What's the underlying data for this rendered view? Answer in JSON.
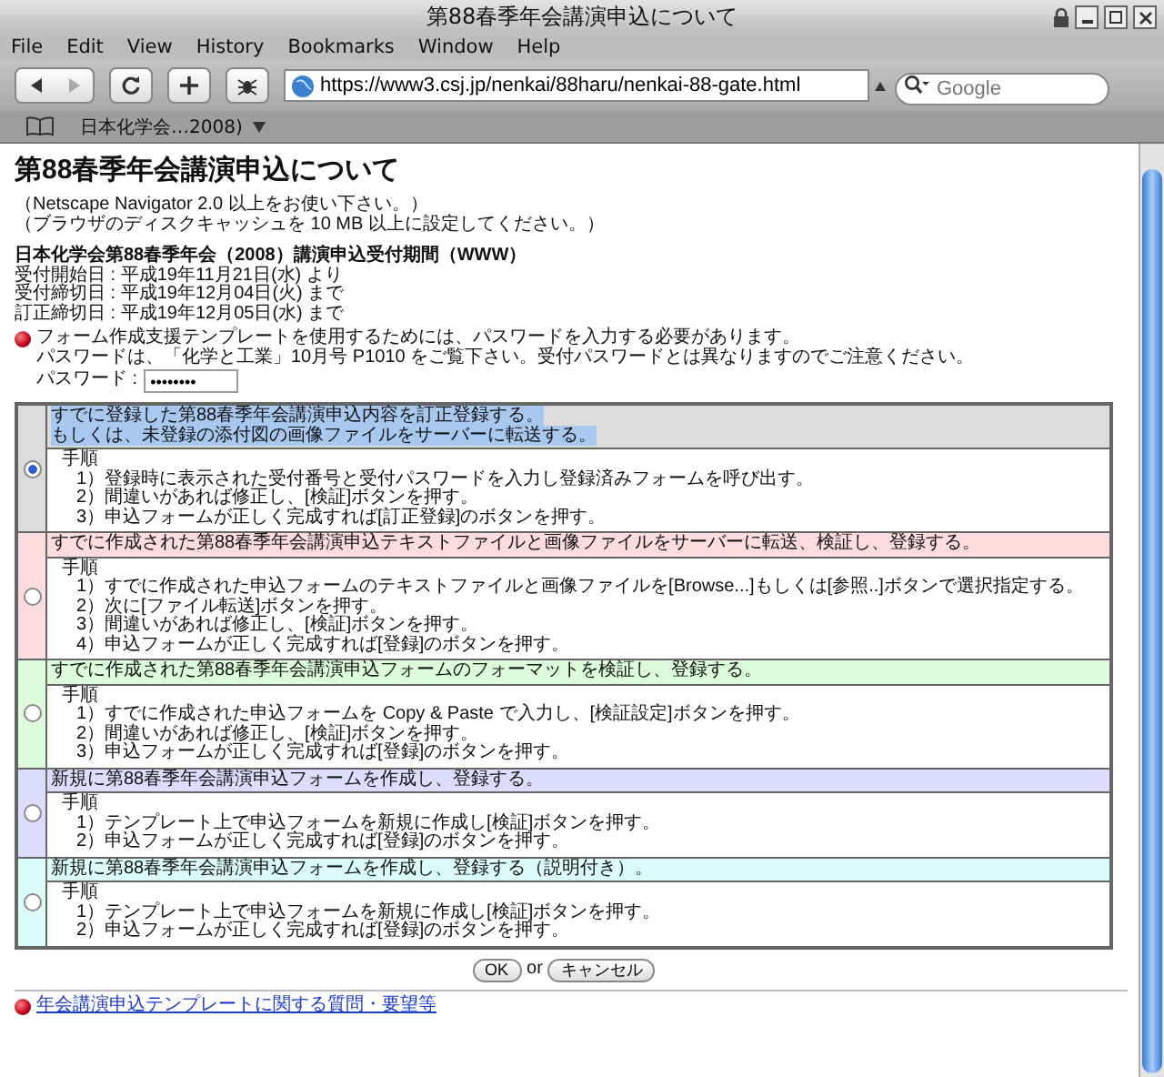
{
  "window": {
    "title": "第88春季年会講演申込について"
  },
  "menu": [
    "File",
    "Edit",
    "View",
    "History",
    "Bookmarks",
    "Window",
    "Help"
  ],
  "toolbar": {
    "url": "https://www3.csj.jp/nenkai/88haru/nenkai-88-gate.html",
    "search_placeholder": "Google"
  },
  "bookmarks": [
    "日本化学会…2008)"
  ],
  "page": {
    "heading": "第88春季年会講演申込について",
    "notes": [
      "（Netscape Navigator 2.0 以上をお使い下さい。）",
      "（ブラウザのディスクキャッシュを 10 MB 以上に設定してください。）"
    ],
    "period_title": "日本化学会第88春季年会（2008）講演申込受付期間（WWW）",
    "period_lines": [
      "受付開始日 : 平成19年11月21日(水) より",
      "受付締切日 : 平成19年12月04日(火) まで",
      "訂正締切日 : 平成19年12月05日(水) まで"
    ],
    "notice_lines": [
      "フォーム作成支援テンプレートを使用するためには、パスワードを入力する必要があります。",
      "パスワードは、「化学と工業」10月号 P1010 をご覧下さい。受付パスワードとは異なりますのでご注意ください。"
    ],
    "password": {
      "label": "パスワード :",
      "value": "••••••••"
    },
    "options": [
      {
        "selected": true,
        "text_selected": true,
        "color": "#dcdcdc",
        "header": [
          "すでに登録した第88春季年会講演申込内容を訂正登録する。",
          "もしくは、未登録の添付図の画像ファイルをサーバーに転送する。"
        ],
        "steps_label": "手順",
        "steps": [
          "1）登録時に表示された受付番号と受付パスワードを入力し登録済みフォームを呼び出す。",
          "2）間違いがあれば修正し、[検証]ボタンを押す。",
          "3）申込フォームが正しく完成すれば[訂正登録]のボタンを押す。"
        ]
      },
      {
        "selected": false,
        "text_selected": false,
        "color": "#fcdcdc",
        "header": [
          "すでに作成された第88春季年会講演申込テキストファイルと画像ファイルをサーバーに転送、検証し、登録する。"
        ],
        "steps_label": "手順",
        "steps": [
          "1）すでに作成された申込フォームのテキストファイルと画像ファイルを[Browse...]もしくは[参照..]ボタンで選択指定する。",
          "2）次に[ファイル転送]ボタンを押す。",
          "3）間違いがあれば修正し、[検証]ボタンを押す。",
          "4）申込フォームが正しく完成すれば[登録]のボタンを押す。"
        ]
      },
      {
        "selected": false,
        "text_selected": false,
        "color": "#dcfcdc",
        "header": [
          "すでに作成された第88春季年会講演申込フォームのフォーマットを検証し、登録する。"
        ],
        "steps_label": "手順",
        "steps": [
          "1）すでに作成された申込フォームを Copy & Paste で入力し、[検証設定]ボタンを押す。",
          "2）間違いがあれば修正し、[検証]ボタンを押す。",
          "3）申込フォームが正しく完成すれば[登録]のボタンを押す。"
        ]
      },
      {
        "selected": false,
        "text_selected": false,
        "color": "#dcdcfc",
        "header": [
          "新規に第88春季年会講演申込フォームを作成し、登録する。"
        ],
        "steps_label": "手順",
        "steps": [
          "1）テンプレート上で申込フォームを新規に作成し[検証]ボタンを押す。",
          "2）申込フォームが正しく完成すれば[登録]のボタンを押す。"
        ]
      },
      {
        "selected": false,
        "text_selected": false,
        "color": "#dcfcfc",
        "header": [
          "新規に第88春季年会講演申込フォームを作成し、登録する（説明付き）。"
        ],
        "steps_label": "手順",
        "steps": [
          "1）テンプレート上で申込フォームを新規に作成し[検証]ボタンを押す。",
          "2）申込フォームが正しく完成すれば[登録]のボタンを押す。"
        ]
      }
    ],
    "ok_button": "OK",
    "or_text": "or",
    "cancel_button": "キャンセル",
    "link": "年会講演申込テンプレートに関する質問・要望等"
  }
}
